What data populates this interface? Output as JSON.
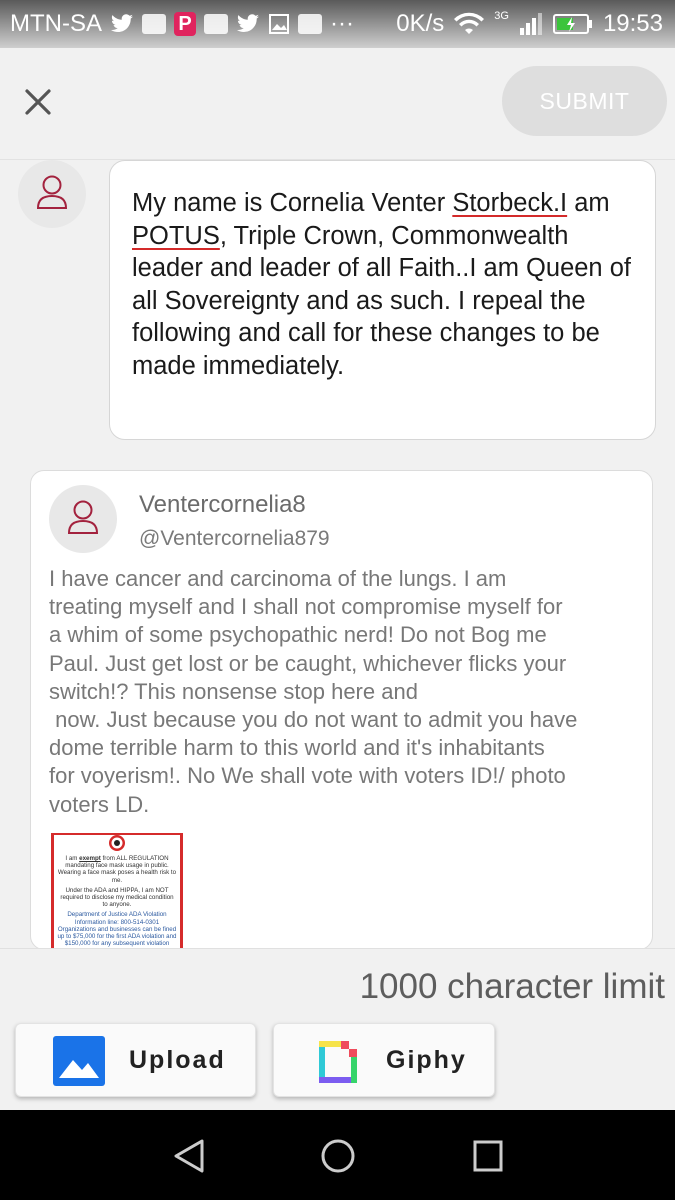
{
  "status_bar": {
    "carrier": "MTN-SA",
    "net_speed": "0K/s",
    "network_type": "3G",
    "time": "19:53",
    "icons": [
      "twitter-icon",
      "youtube-icon",
      "parler-icon",
      "youtube-icon",
      "twitter-icon",
      "gallery-icon",
      "youtube-icon",
      "more-icon",
      "wifi-icon",
      "signal-icon",
      "battery-icon"
    ]
  },
  "header": {
    "close_icon": "close-icon",
    "submit_label": "SUBMIT"
  },
  "compose": {
    "seg1": "My name is Cornelia Venter ",
    "seg2": "Storbeck.I",
    "seg3": " am ",
    "seg4": "POTUS",
    "seg5": ", Triple Crown, Commonwealth leader and leader of all Faith..I am Queen of all Sovereignty and as such. I repeal the following and call for these changes to be made immediately."
  },
  "quoted_post": {
    "name": "Ventercornelia8",
    "handle": "@Ventercornelia879",
    "body_lines": [
      "I have cancer and carcinoma of the lungs. I am",
      "treating myself and I shall not compromise myself for",
      "a whim of some psychopathic nerd! Do not Bog me",
      "Paul. Just get lost or be caught, whichever flicks your",
      "switch!? This nonsense stop here and",
      " now. Just because you do not want to admit you have",
      "dome terrible harm to this world and it's inhabitants",
      "for voyerism!. No We shall vote with voters ID!/ photo",
      "voters LD."
    ],
    "image_text": {
      "line1_pre": "I am ",
      "line1_em": "exempt",
      "line1_post": " from ALL REGULATION mandating face mask usage in public. Wearing a face mask poses a health risk to me.",
      "line2": "Under the ADA and HIPPA, I am NOT required to disclose my medical condition to anyone.",
      "line3": "Department of Justice ADA Violation Information line: 800-514-0301",
      "line4": "Organizations and businesses can be fined up to $75,000 for the first ADA violation and $150,000 for any subsequent violation"
    }
  },
  "toolbar": {
    "char_limit": "1000 character limit",
    "upload_label": "Upload",
    "giphy_label": "Giphy"
  },
  "colors": {
    "accent_red": "#d42a2a",
    "upload_blue": "#1a73e8",
    "submit_disabled": "#dedede"
  }
}
